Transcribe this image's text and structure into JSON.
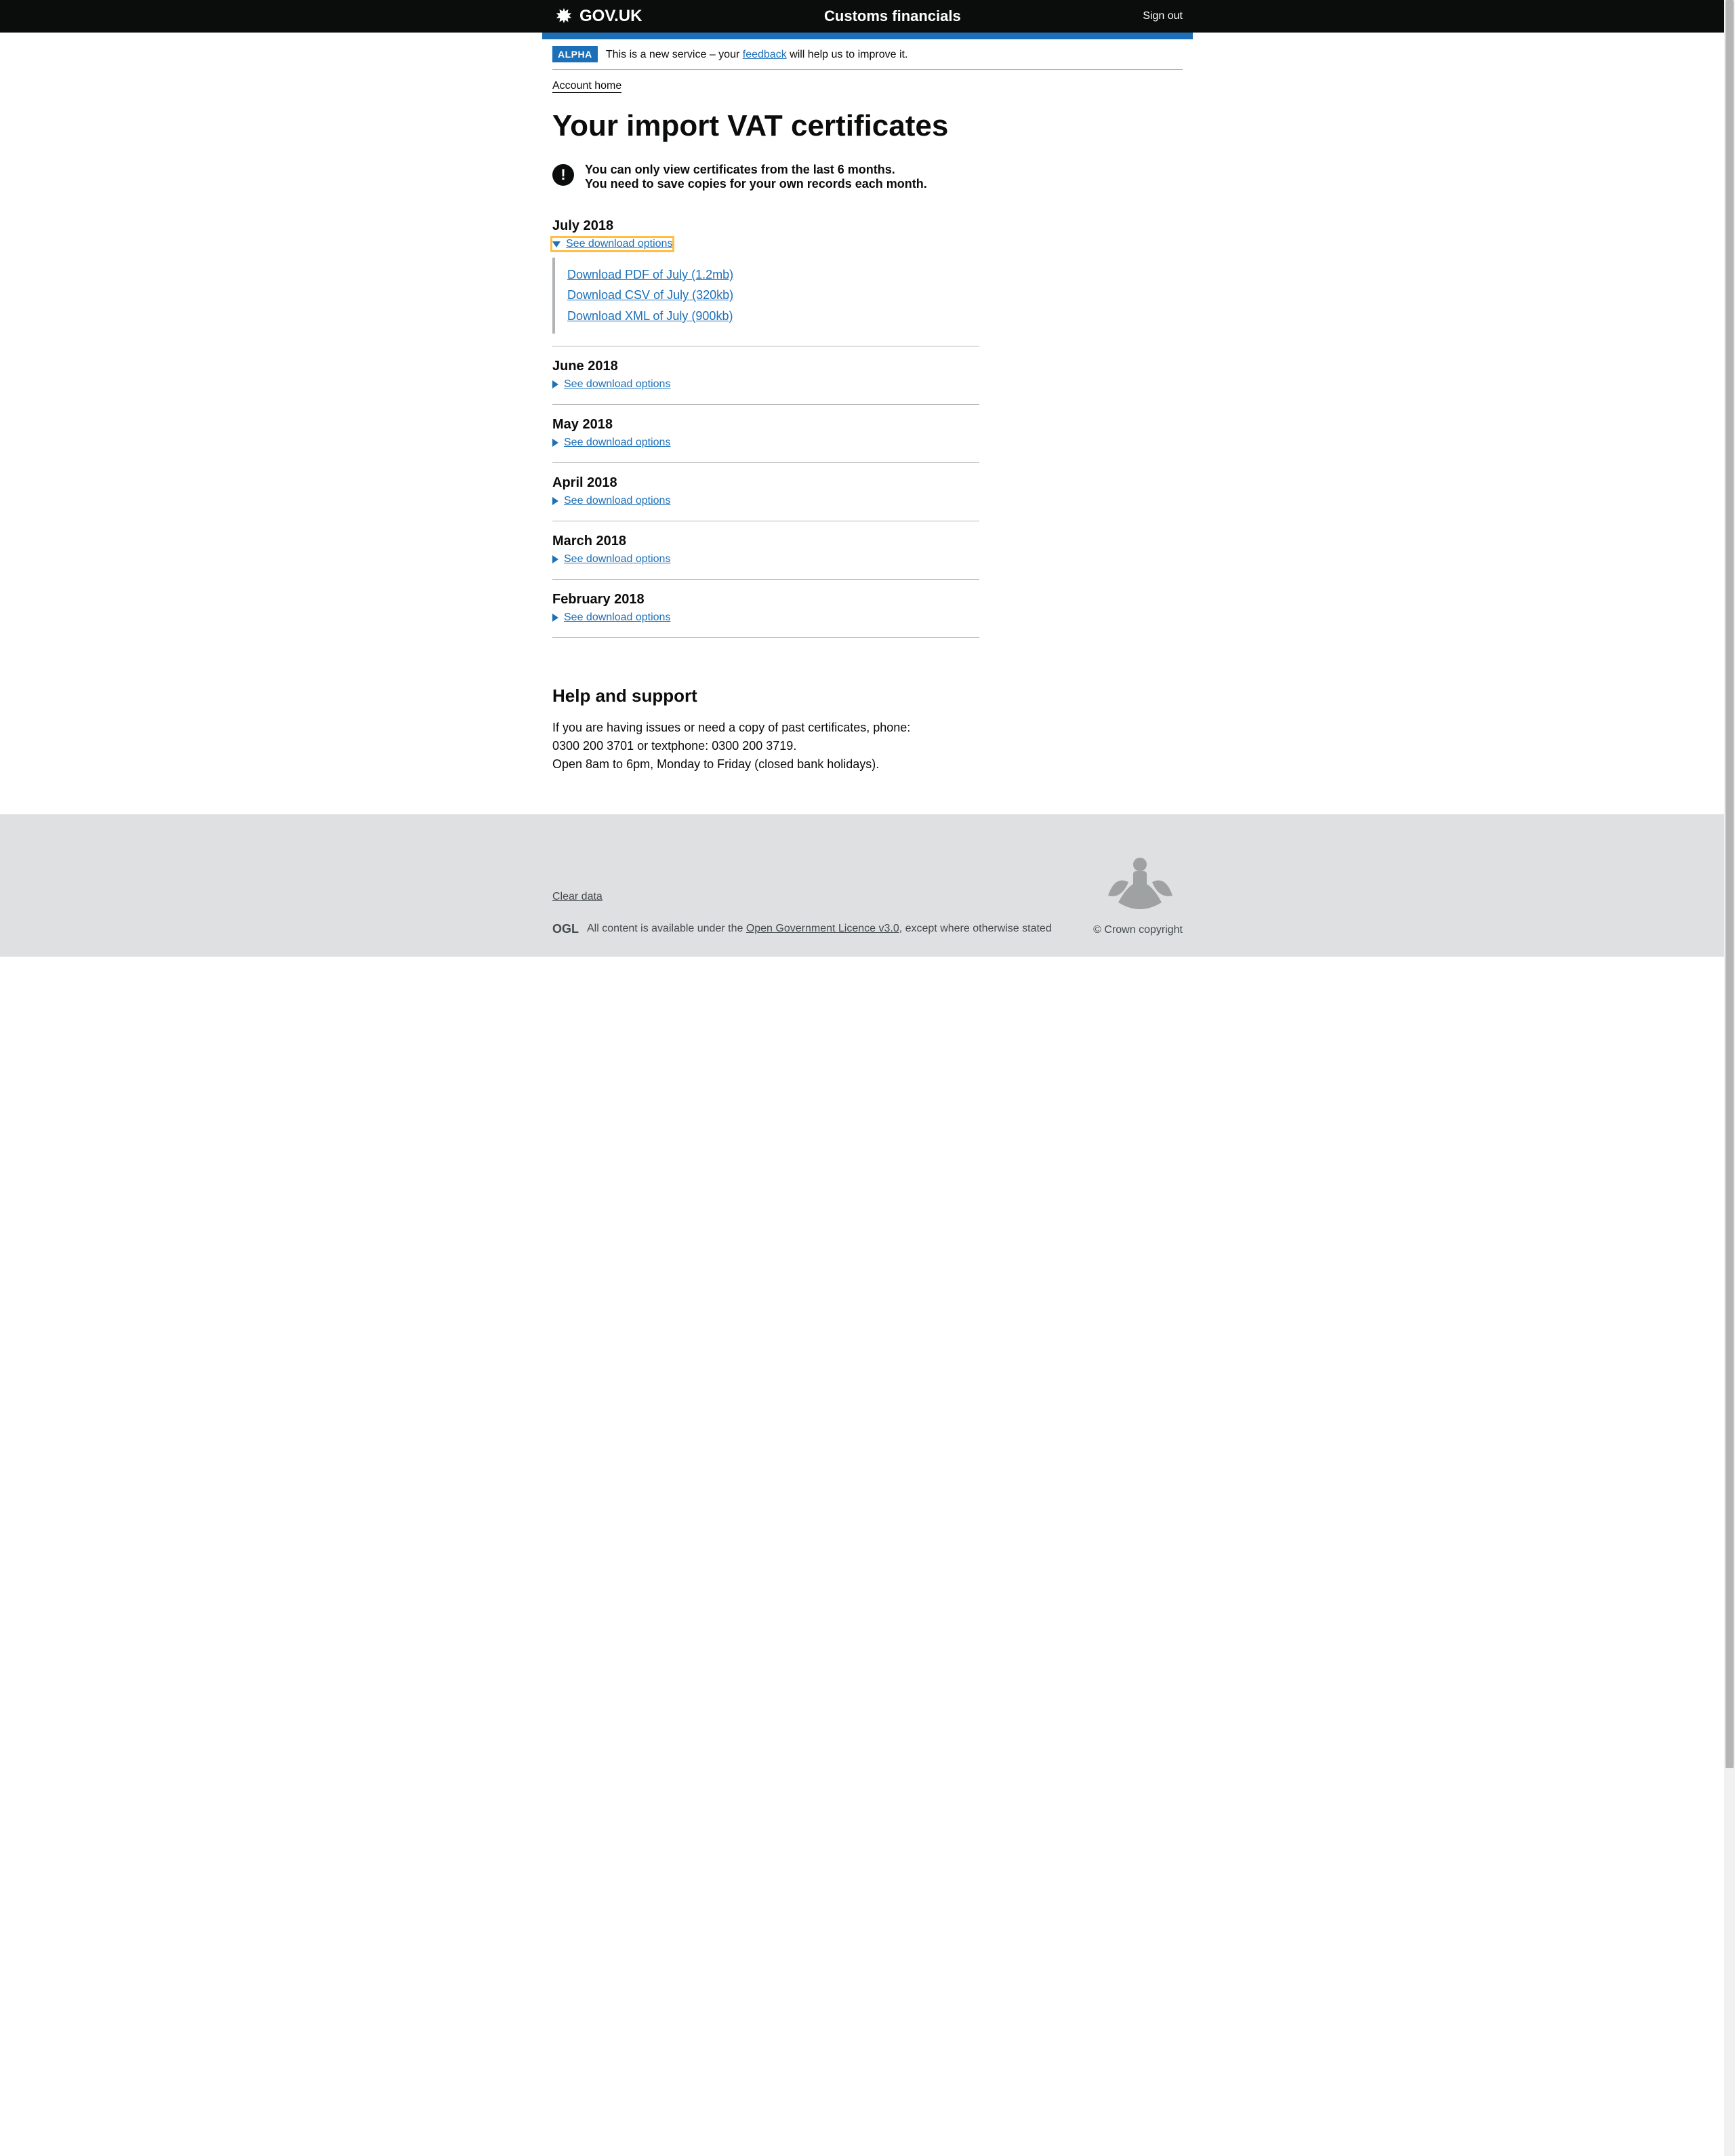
{
  "header": {
    "logo_text": "GOV.UK",
    "service_name": "Customs financials",
    "sign_out": "Sign out"
  },
  "phase": {
    "tag": "ALPHA",
    "text_before": "This is a new service – your ",
    "link": "feedback",
    "text_after": " will help us to improve it."
  },
  "nav": {
    "account_home": "Account home"
  },
  "page": {
    "title": "Your import VAT certificates",
    "important_line_1": "You can only view certificates from the last 6 months.",
    "important_line_2": "You need to save copies for your own records each month."
  },
  "months": [
    {
      "label": "July 2018",
      "summary": "See download options",
      "open": true,
      "downloads": {
        "pdf": "Download PDF of July (1.2mb)",
        "csv": "Download CSV of July (320kb)",
        "xml": "Download XML of July (900kb)"
      }
    },
    {
      "label": "June 2018",
      "summary": "See download options",
      "open": false
    },
    {
      "label": "May 2018",
      "summary": "See download options",
      "open": false
    },
    {
      "label": "April 2018",
      "summary": "See download options",
      "open": false
    },
    {
      "label": "March 2018",
      "summary": "See download options",
      "open": false
    },
    {
      "label": "February 2018",
      "summary": "See download options",
      "open": false
    }
  ],
  "help": {
    "title": "Help and support",
    "line1": "If you are having issues or need a copy of past certificates, phone:",
    "line2": "0300 200 3701 or textphone: 0300 200 3719.",
    "line3": "Open 8am to 6pm, Monday to Friday (closed bank holidays)."
  },
  "footer": {
    "clear_data": "Clear data",
    "ogl_prefix": "All content is available under the ",
    "ogl_link": "Open Government Licence v3.0",
    "ogl_suffix": ", except where otherwise stated",
    "copyright": "© Crown copyright",
    "ogl_abbrev": "OGL"
  }
}
